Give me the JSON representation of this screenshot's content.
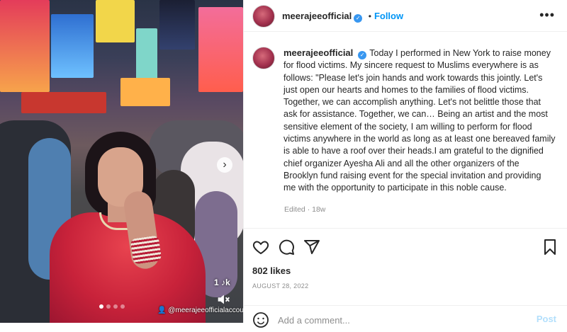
{
  "post": {
    "username": "meerajeeofficial",
    "follow_label": "Follow",
    "separator": "•",
    "more_label": "•••",
    "caption": "Today I performed in New York to raise money for flood victims. My sincere request to Muslims everywhere is as follows: \"Please let's join hands and work towards this jointly. Let's just open our hearts and homes to the families of flood victims. Together, we can accomplish anything. Let's not belittle those that ask for assistance. Together, we can… Being an artist and the most sensitive element of the society, I am willing to perform for flood victims anywhere in the world as long as at least one bereaved family is able to have a roof over their heads.I am grateful to the dignified chief organizer Ayesha Ali and all the other organizers of the Brooklyn fund raising event for the special invitation and providing me with the opportunity to participate in this noble cause.",
    "edited_meta": "Edited · 18w",
    "likes": "802 likes",
    "date": "AUGUST 28, 2022",
    "comment_placeholder": "Add a comment...",
    "post_label": "Post"
  },
  "media": {
    "tiktok_mark": "1 ♪k",
    "account_tag": "👤 @meerajeeofficialaccount",
    "carousel_count": 4,
    "carousel_active": 0
  },
  "colors": {
    "accent": "#0095f6",
    "verified": "#3897f0",
    "text": "#262626",
    "muted": "#8e8e8e"
  },
  "icons": [
    "verified-badge-icon",
    "more-options-icon",
    "heart-icon",
    "comment-icon",
    "share-icon",
    "save-icon",
    "emoji-icon",
    "carousel-next-icon",
    "mute-icon"
  ]
}
